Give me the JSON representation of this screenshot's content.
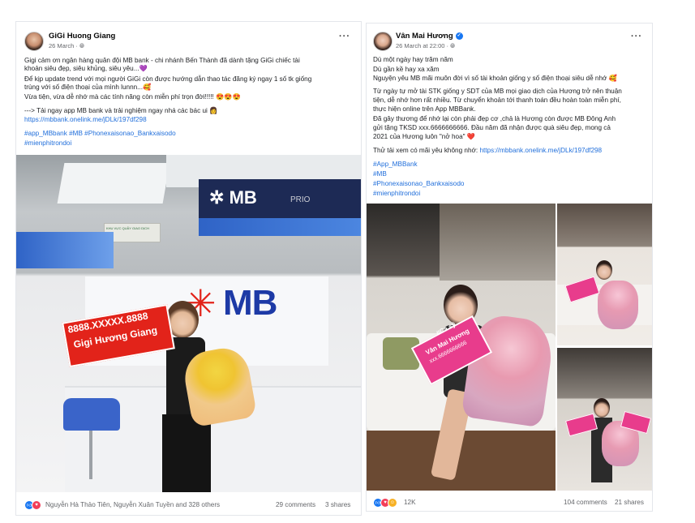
{
  "post1": {
    "author": "GiGi Huong Giang",
    "date": "26 March",
    "more": "···",
    "lines": [
      "Gigi cảm ơn ngân hàng quân đội MB bank - chi nhánh Bến Thành đã dành tặng GiGi chiếc tài",
      "khoản siêu đẹp, siêu khủng, siêu yêu...💜",
      "Để kịp update trend với mọi người GiGi còn được hướng dẫn thao tác đăng ký ngay 1 số tk giống",
      "trùng với số điện thoại của mình lunnn...🥰",
      "Vừa tiện, vừa dễ nhớ mà các tính năng còn miễn phí trọn đời!!!!! 😍😍😍"
    ],
    "cta": "---> Tải ngay app MB bank và trải nghiệm ngay nhá các bác ui 👩",
    "link": "https://mbbank.onelink.me/jDLk/197df298",
    "tags_line": "#app_MBbank #MB #Phonexaisonao_Bankxaisodo",
    "tags_line2": "#mienphitrondoi",
    "photo": {
      "sign_mb": "MB",
      "sign_prio": "PRIO",
      "wall_logo": "MB",
      "kiosk_sign": "KHU VỰC QUẦY GIAO DỊCH",
      "card_line1": "8888.XXXXX.8888",
      "card_line2": "Gigi Hương Giang"
    },
    "reactors": "Nguyễn Hà Thảo Tiên, Nguyễn Xuân Tuyền and 328 others",
    "comments": "29 comments",
    "shares": "3 shares"
  },
  "post2": {
    "author": "Vân Mai Hương",
    "date": "26 March at 22:00",
    "more": "···",
    "lines": [
      "Dù một ngày hay trăm năm",
      "Dù gần kề hay xa xăm",
      "Nguyện yêu MB mãi muôn đời vì số tài khoản giống y số điện thoại siêu dễ nhớ 🥰",
      "Từ ngày tự mở tài STK giống y SDT của MB mọi giao dịch của Hương trở nên thuận",
      "tiện, dễ nhớ hơn rất nhiều. Từ chuyển khoản tới thanh toán đều hoàn toàn miễn phí,",
      "thực hiện online trên App MBBank.",
      "Đã gây thương để nhớ lại còn phải đẹp cơ ,chả là Hương còn được MB Đông Anh",
      "gửi tặng TKSD xxx.6666666666. Đầu năm đã nhận được quà siêu đẹp, mong cả",
      "2021 của Hương luôn \"nở hoa\" ❤️"
    ],
    "try_prefix": "Thử tải xem có mãi yêu không nhớ: ",
    "link": "https://mbbank.onelink.me/jDLk/197df298",
    "tags": [
      "#App_MBBank",
      "#MB",
      "#Phonexaisonao_Bankxaisodo",
      "#mienphitrondoi"
    ],
    "photo": {
      "card_line1": "#Ca sỹ",
      "card_line2": "Vân Mai Hương",
      "card_line3": "xxx.6666666666"
    },
    "reactions_count": "12K",
    "comments": "104 comments",
    "shares": "21 shares"
  },
  "colors": {
    "link": "#216fdb",
    "mb_blue": "#1d3aa6",
    "mb_red": "#e2231a",
    "like": "#1877f2",
    "love": "#f33e58",
    "haha": "#f7b125"
  },
  "icons": [
    "globe-icon",
    "more-icon",
    "verified-badge-icon",
    "like-reaction-icon",
    "love-reaction-icon",
    "haha-reaction-icon"
  ]
}
